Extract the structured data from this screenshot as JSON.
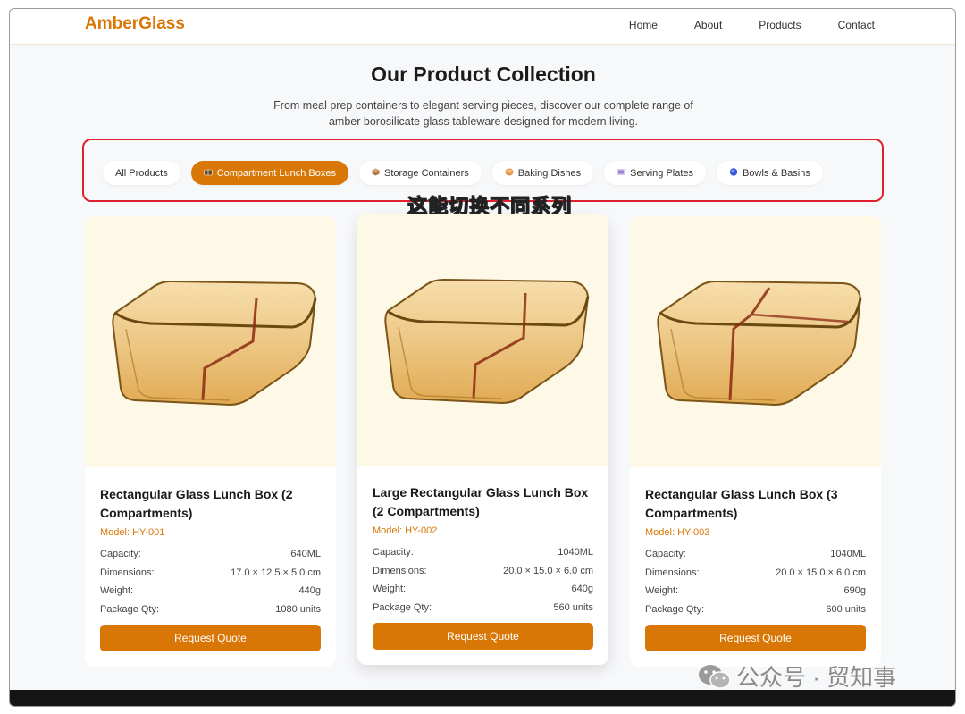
{
  "brand": "AmberGlass",
  "nav": [
    "Home",
    "About",
    "Products",
    "Contact"
  ],
  "hero": {
    "title": "Our Product Collection",
    "subtitle": "From meal prep containers to elegant serving pieces, discover our complete range of amber borosilicate glass tableware designed for modern living."
  },
  "filters": [
    {
      "label": "All Products",
      "icon": "",
      "active": false
    },
    {
      "label": "Compartment Lunch Boxes",
      "icon": "lunchbox-icon",
      "active": true
    },
    {
      "label": "Storage Containers",
      "icon": "box-icon",
      "active": false
    },
    {
      "label": "Baking Dishes",
      "icon": "bread-icon",
      "active": false
    },
    {
      "label": "Serving Plates",
      "icon": "plate-icon",
      "active": false
    },
    {
      "label": "Bowls & Basins",
      "icon": "bowl-icon",
      "active": false
    }
  ],
  "annotation": "这能切换不同系列",
  "spec_labels": {
    "capacity": "Capacity:",
    "dimensions": "Dimensions:",
    "weight": "Weight:",
    "package": "Package Qty:"
  },
  "button_label": "Request Quote",
  "products": [
    {
      "name": "Rectangular Glass Lunch Box (2 Compartments)",
      "model": "Model: HY-001",
      "capacity": "640ML",
      "dimensions": "17.0 × 12.5 × 5.0 cm",
      "weight": "440g",
      "package": "1080 units",
      "compartments": 2
    },
    {
      "name": "Large Rectangular Glass Lunch Box (2 Compartments)",
      "model": "Model: HY-002",
      "capacity": "1040ML",
      "dimensions": "20.0 × 15.0 × 6.0 cm",
      "weight": "640g",
      "package": "560 units",
      "compartments": 2
    },
    {
      "name": "Rectangular Glass Lunch Box (3 Compartments)",
      "model": "Model: HY-003",
      "capacity": "1040ML",
      "dimensions": "20.0 × 15.0 × 6.0 cm",
      "weight": "690g",
      "package": "600 units",
      "compartments": 3
    }
  ],
  "watermark": "公众号 · 贸知事",
  "colors": {
    "accent": "#d97706",
    "highlight_border": "#e0202e",
    "annotation": "#fde047"
  }
}
